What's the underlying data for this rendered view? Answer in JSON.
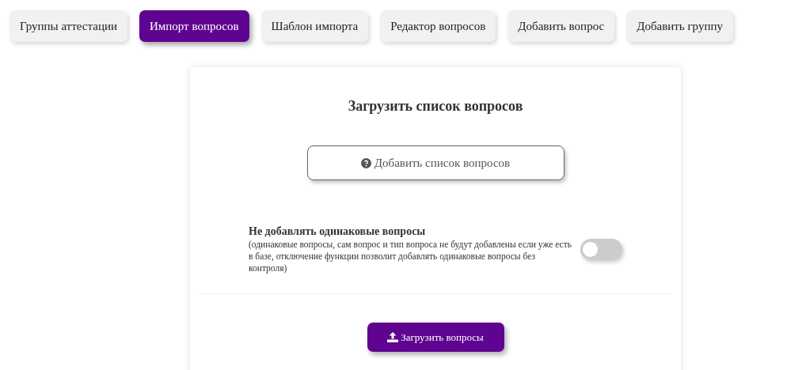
{
  "tabs": [
    {
      "label": "Группы аттестации",
      "selected": false
    },
    {
      "label": "Импорт вопросов",
      "selected": true
    },
    {
      "label": "Шаблон импорта",
      "selected": false
    },
    {
      "label": "Редактор вопросов",
      "selected": false
    },
    {
      "label": "Добавить вопрос",
      "selected": false
    },
    {
      "label": "Добавить группу",
      "selected": false
    }
  ],
  "card": {
    "title": "Загрузить список вопросов",
    "add_list_button": "Добавить список вопросов",
    "option": {
      "label": "Не добавлять одинаковые вопросы",
      "description": "(одинаковые вопросы, сам вопрос и тип вопроса не будут добавлены если уже есть в базе, отключение функции позволит добавлять одинаковые вопросы без контроля)",
      "on": false
    },
    "upload_button": "Загрузить вопросы"
  }
}
